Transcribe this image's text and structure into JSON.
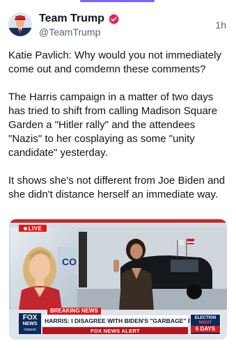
{
  "post": {
    "display_name": "Team Trump",
    "handle": "@TeamTrump",
    "time": "1h",
    "paragraphs": [
      "Katie Pavlich: Why would you not immediately come out and comdemn these comments?",
      "The Harris campaign in a matter of two days has tried to shift from calling Madison Square Garden a \"Hitler rally\" and the attendees \"Nazis\" to her cosplaying as some \"unity candidate\" yesterday.",
      "It shows she's not different from Joe Biden and she didn't distance herself an immediate way."
    ]
  },
  "media": {
    "live_label": "LIVE",
    "breaking_label": "BREAKING NEWS",
    "headline": "HARRIS: I DISAGREE WITH BIDEN'S \"GARBAGE\" REMARK",
    "alert_label": "FOX NEWS ALERT",
    "network_logo_line1": "FOX",
    "network_logo_line2": "NEWS",
    "network_logo_line3": "channel",
    "election_line1": "ELECTION",
    "election_line2": "NIGHT",
    "election_countdown": "6 DAYS"
  },
  "colors": {
    "verified_badge": "#e0245e",
    "fox_red": "#d71920",
    "fox_navy": "#0b2a5b",
    "accent_bar": "#7b61ff"
  },
  "icons": {
    "verified": "verified-badge-icon",
    "live_dot": "live-dot-icon"
  }
}
